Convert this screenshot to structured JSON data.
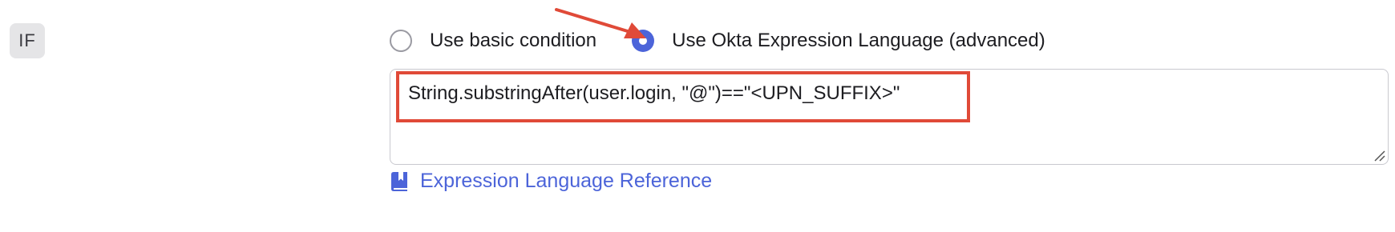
{
  "condition": {
    "if_label": "IF"
  },
  "radio_options": {
    "basic": {
      "label": "Use basic condition",
      "selected": false
    },
    "advanced": {
      "label": "Use Okta Expression Language (advanced)",
      "selected": true
    }
  },
  "expression": {
    "value": "String.substringAfter(user.login, \"@\")==\"<UPN_SUFFIX>\""
  },
  "reference_link": {
    "label": "Expression Language Reference",
    "icon": "book-icon"
  },
  "colors": {
    "accent": "#4c64d9",
    "annotation": "#e04a38",
    "badge_bg": "#e5e5e7"
  }
}
